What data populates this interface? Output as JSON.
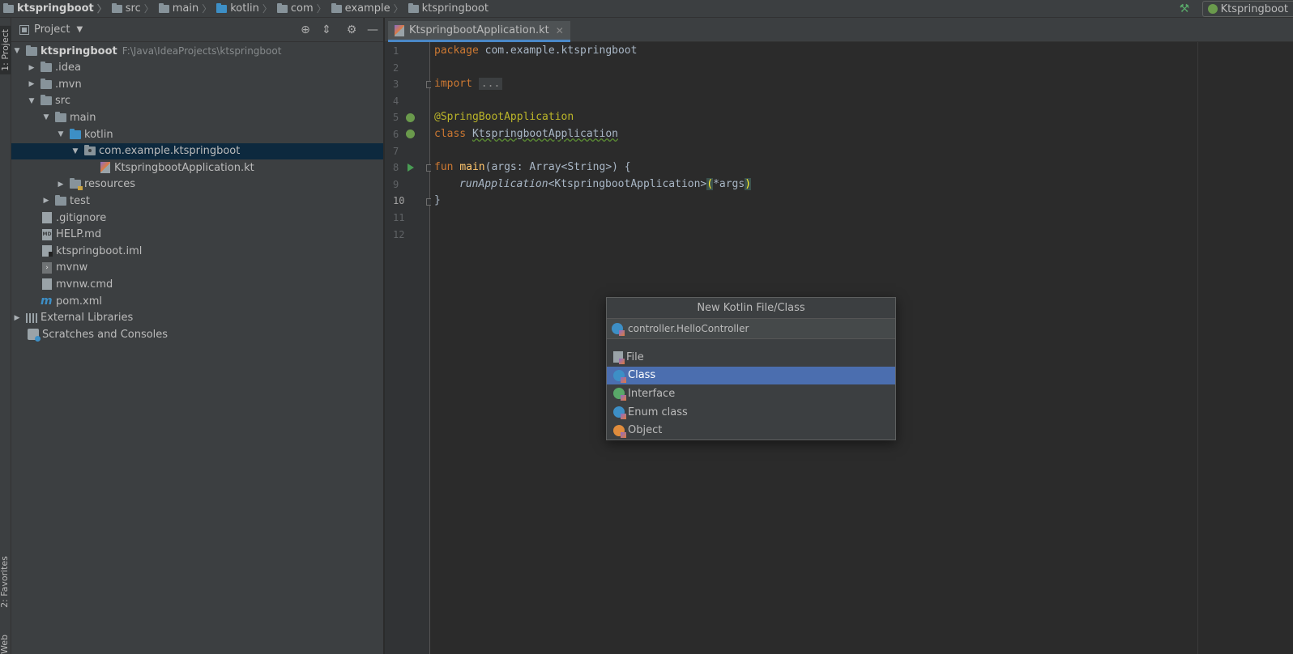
{
  "breadcrumb": [
    "ktspringboot",
    "src",
    "main",
    "kotlin",
    "com",
    "example",
    "ktspringboot"
  ],
  "run_config": {
    "label": "Ktspringboot"
  },
  "left_stripe": {
    "project_tab": "1: Project",
    "favorites_tab": "2: Favorites",
    "web_tab": "Web"
  },
  "project_panel": {
    "title": "Project",
    "tree": [
      {
        "label": "ktspringboot",
        "path": "F:\\Java\\IdeaProjects\\ktspringboot"
      },
      {
        "label": ".idea"
      },
      {
        "label": ".mvn"
      },
      {
        "label": "src"
      },
      {
        "label": "main"
      },
      {
        "label": "kotlin"
      },
      {
        "label": "com.example.ktspringboot"
      },
      {
        "label": "KtspringbootApplication.kt"
      },
      {
        "label": "resources"
      },
      {
        "label": "test"
      },
      {
        "label": ".gitignore"
      },
      {
        "label": "HELP.md"
      },
      {
        "label": "ktspringboot.iml"
      },
      {
        "label": "mvnw"
      },
      {
        "label": "mvnw.cmd"
      },
      {
        "label": "pom.xml"
      },
      {
        "label": "External Libraries"
      },
      {
        "label": "Scratches and Consoles"
      }
    ]
  },
  "editor": {
    "tab_label": "KtspringbootApplication.kt",
    "line_numbers": [
      "1",
      "2",
      "3",
      "4",
      "5",
      "6",
      "7",
      "8",
      "9",
      "10",
      "11",
      "12"
    ],
    "code": {
      "l1_kw": "package",
      "l1_rest": " com.example.ktspringboot",
      "l3_kw": "import",
      "l3_fold": "...",
      "l6_ann": "@SpringBootApplication",
      "l7_kw": "class",
      "l7_name": "KtspringbootApplication",
      "l9_kw": "fun",
      "l9_fn": "main",
      "l9_rest": "(args: Array<String>) {",
      "l10_it": "runApplication",
      "l10_type": "<KtspringbootApplication>",
      "l10_open": "(",
      "l10_args": "*args",
      "l10_close": ")",
      "l11": "}"
    }
  },
  "dialog": {
    "title": "New Kotlin File/Class",
    "name_value": "controller.HelloController",
    "kinds": [
      "File",
      "Class",
      "Interface",
      "Enum class",
      "Object"
    ],
    "selected_kind": "Class"
  }
}
